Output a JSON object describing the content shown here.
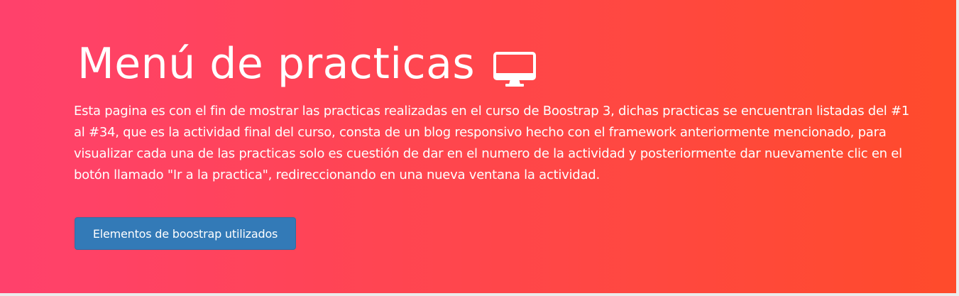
{
  "header": {
    "title": "Menú de practicas",
    "title_icon": "monitor-icon",
    "description": "Esta pagina es con el fin de mostrar las practicas realizadas en el curso de Boostrap 3, dichas practicas se encuentran listadas del #1 al #34, que es la actividad final del curso, consta de un blog responsivo hecho con el framework anteriormente mencionado, para visualizar cada una de las practicas solo es cuestión de dar en el numero de la actividad y posteriormente dar nuevamente clic en el botón llamado \"Ir a la practica\", redireccionando en una nueva ventana la actividad.",
    "button_label": "Elementos de boostrap utilizados"
  },
  "colors": {
    "gradient_start": "#ff416c",
    "gradient_end": "#ff4b2b",
    "button_bg": "#337ab7",
    "text": "#ffffff"
  }
}
